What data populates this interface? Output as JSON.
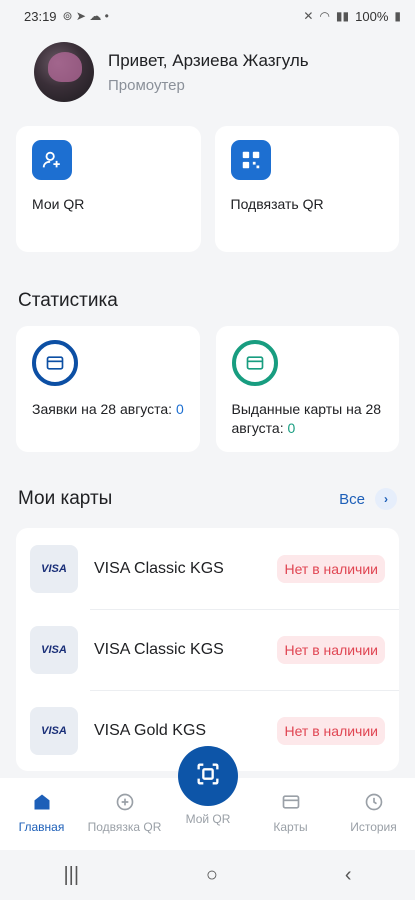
{
  "status_bar": {
    "time": "23:19",
    "battery": "100%"
  },
  "header": {
    "greeting": "Привет, Арзиева Жазгуль",
    "role": "Промоутер"
  },
  "quick_actions": [
    {
      "label": "Мои QR",
      "icon": "add-user-icon"
    },
    {
      "label": "Подвязать QR",
      "icon": "qr-code-icon"
    }
  ],
  "statistics": {
    "title": "Статистика",
    "items": [
      {
        "label": "Заявки на 28 августа: ",
        "value": "0",
        "color": "#0c4fa4"
      },
      {
        "label": "Выданные карты на 28 августа: ",
        "value": "0",
        "color": "#189d80"
      }
    ]
  },
  "my_cards": {
    "title": "Мои карты",
    "all_label": "Все",
    "items": [
      {
        "logo": "VISA",
        "name": "VISA Classic KGS",
        "status": "Нет в наличии"
      },
      {
        "logo": "VISA",
        "name": "VISA Classic KGS",
        "status": "Нет в наличии"
      },
      {
        "logo": "VISA",
        "name": "VISA Gold KGS",
        "status": "Нет в наличии"
      }
    ]
  },
  "bottom_nav": {
    "items": [
      {
        "label": "Главная",
        "icon": "home-icon",
        "active": true
      },
      {
        "label": "Подвязка QR",
        "icon": "plus-circle-icon",
        "active": false
      },
      {
        "label": "Мой QR",
        "icon": "scan-icon",
        "active": false
      },
      {
        "label": "Карты",
        "icon": "card-icon",
        "active": false
      },
      {
        "label": "История",
        "icon": "clock-icon",
        "active": false
      }
    ]
  },
  "colors": {
    "accent": "#1d6fd1",
    "brand_dark": "#0d55a8",
    "green": "#189d80",
    "badge_red": "#e04552"
  }
}
